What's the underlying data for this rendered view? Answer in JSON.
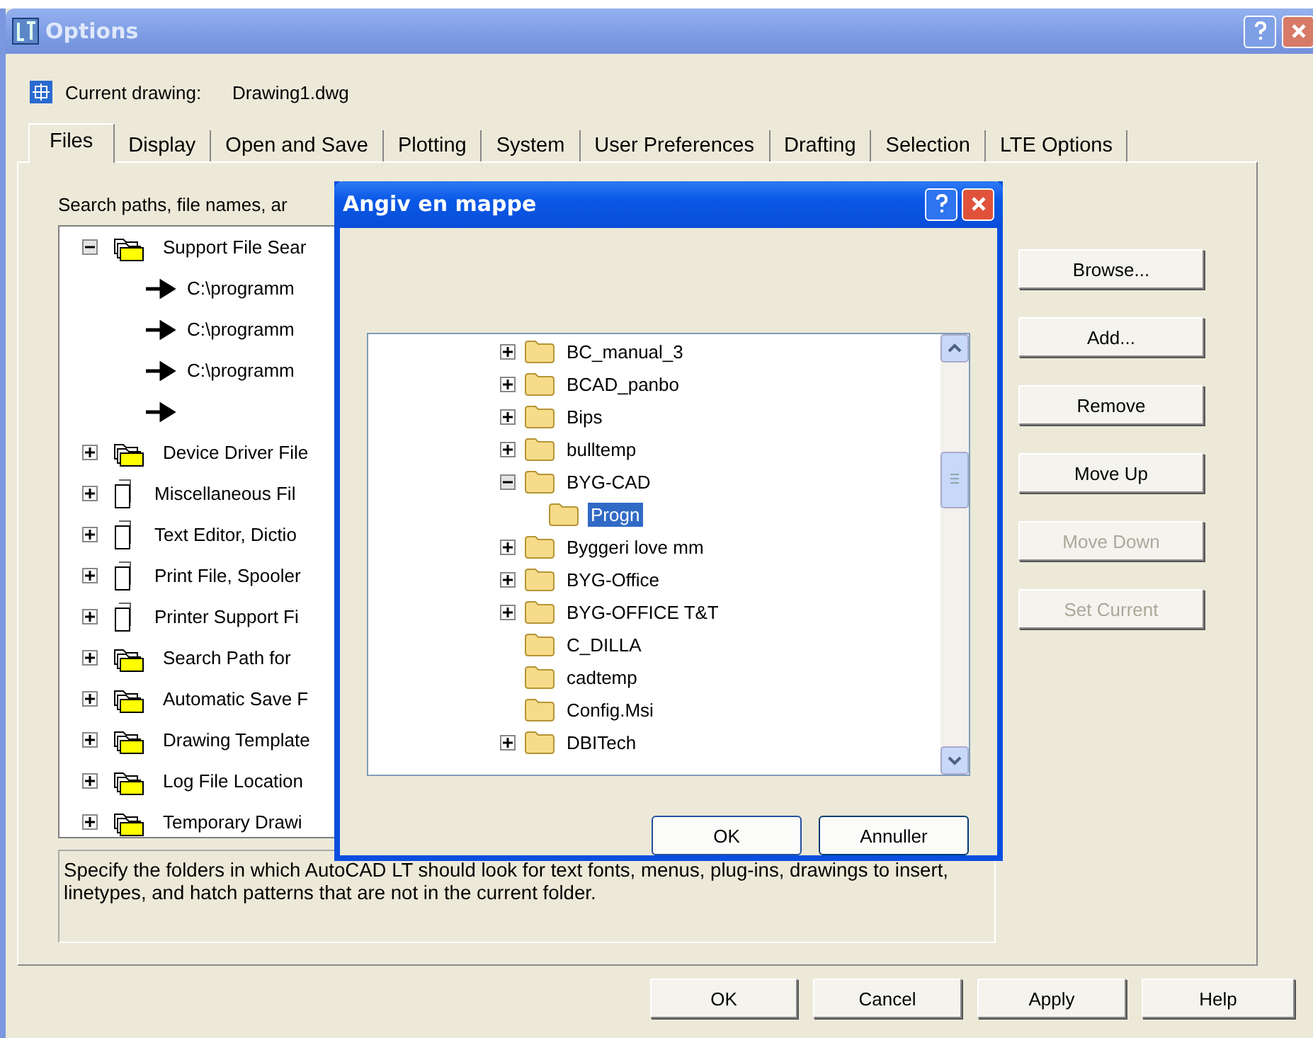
{
  "window": {
    "title": "Options"
  },
  "current_drawing": {
    "label": "Current drawing:",
    "value": "Drawing1.dwg"
  },
  "tabs": [
    {
      "label": "Files",
      "selected": true
    },
    {
      "label": "Display",
      "selected": false
    },
    {
      "label": "Open and Save",
      "selected": false
    },
    {
      "label": "Plotting",
      "selected": false
    },
    {
      "label": "System",
      "selected": false
    },
    {
      "label": "User Preferences",
      "selected": false
    },
    {
      "label": "Drafting",
      "selected": false
    },
    {
      "label": "Selection",
      "selected": false
    },
    {
      "label": "LTE Options",
      "selected": false
    }
  ],
  "panel_label": "Search paths, file names, ar",
  "tree": [
    {
      "label": "Support File Sear",
      "kind": "folders",
      "expandable": true,
      "expanded": true,
      "children": [
        {
          "label": "C:\\programm",
          "kind": "path",
          "expandable": false
        },
        {
          "label": "C:\\programm",
          "kind": "path",
          "expandable": false
        },
        {
          "label": "C:\\programm",
          "kind": "path",
          "expandable": false
        },
        {
          "kind": "path",
          "expandable": false
        }
      ]
    },
    {
      "label": "Device Driver File",
      "kind": "folders",
      "expandable": true,
      "expanded": false
    },
    {
      "label": "Miscellaneous Fil",
      "kind": "files",
      "expandable": true,
      "expanded": false
    },
    {
      "label": "Text Editor, Dictio",
      "kind": "files",
      "expandable": true,
      "expanded": false
    },
    {
      "label": "Print File, Spooler",
      "kind": "files",
      "expandable": true,
      "expanded": false
    },
    {
      "label": "Printer Support Fi",
      "kind": "files",
      "expandable": true,
      "expanded": false
    },
    {
      "label": "Search Path for",
      "kind": "folders",
      "expandable": true,
      "expanded": false
    },
    {
      "label": "Automatic Save F",
      "kind": "folders",
      "expandable": true,
      "expanded": false
    },
    {
      "label": "Drawing Template",
      "kind": "folders",
      "expandable": true,
      "expanded": false
    },
    {
      "label": "Log File Location",
      "kind": "folders",
      "expandable": true,
      "expanded": false
    },
    {
      "label": "Temporary Drawi",
      "kind": "folders",
      "expandable": true,
      "expanded": false
    }
  ],
  "side_buttons": [
    {
      "label": "Browse...",
      "disabled": false
    },
    {
      "label": "Add...",
      "disabled": false
    },
    {
      "label": "Remove",
      "disabled": false
    },
    {
      "label": "Move Up",
      "disabled": false
    },
    {
      "label": "Move Down",
      "disabled": true
    },
    {
      "label": "Set Current",
      "disabled": true
    }
  ],
  "description": "Specify the folders in which AutoCAD LT should look for text fonts, menus, plug-ins, drawings to insert, linetypes, and hatch patterns that are not in the current folder.",
  "buttons": [
    "OK",
    "Cancel",
    "Apply",
    "Help"
  ],
  "dialog": {
    "title": "Angiv en mappe",
    "folders": [
      {
        "label": "BC_manual_3",
        "expandable": true,
        "expanded": false,
        "selected": false
      },
      {
        "label": "BCAD_panbo",
        "expandable": true,
        "expanded": false,
        "selected": false
      },
      {
        "label": "Bips",
        "expandable": true,
        "expanded": false,
        "selected": false
      },
      {
        "label": "bulltemp",
        "expandable": true,
        "expanded": false,
        "selected": false
      },
      {
        "label": "BYG-CAD",
        "expandable": true,
        "expanded": true,
        "selected": false,
        "children": [
          {
            "label": "Progn",
            "expandable": false,
            "selected": true
          }
        ]
      },
      {
        "label": "Byggeri love mm",
        "expandable": true,
        "expanded": false,
        "selected": false
      },
      {
        "label": "BYG-Office",
        "expandable": true,
        "expanded": false,
        "selected": false
      },
      {
        "label": "BYG-OFFICE T&T",
        "expandable": true,
        "expanded": false,
        "selected": false
      },
      {
        "label": "C_DILLA",
        "expandable": false,
        "selected": false
      },
      {
        "label": "cadtemp",
        "expandable": false,
        "selected": false
      },
      {
        "label": "Config.Msi",
        "expandable": false,
        "selected": false
      },
      {
        "label": "DBITech",
        "expandable": true,
        "expanded": false,
        "selected": false
      }
    ],
    "buttons": [
      "OK",
      "Annuller"
    ]
  }
}
